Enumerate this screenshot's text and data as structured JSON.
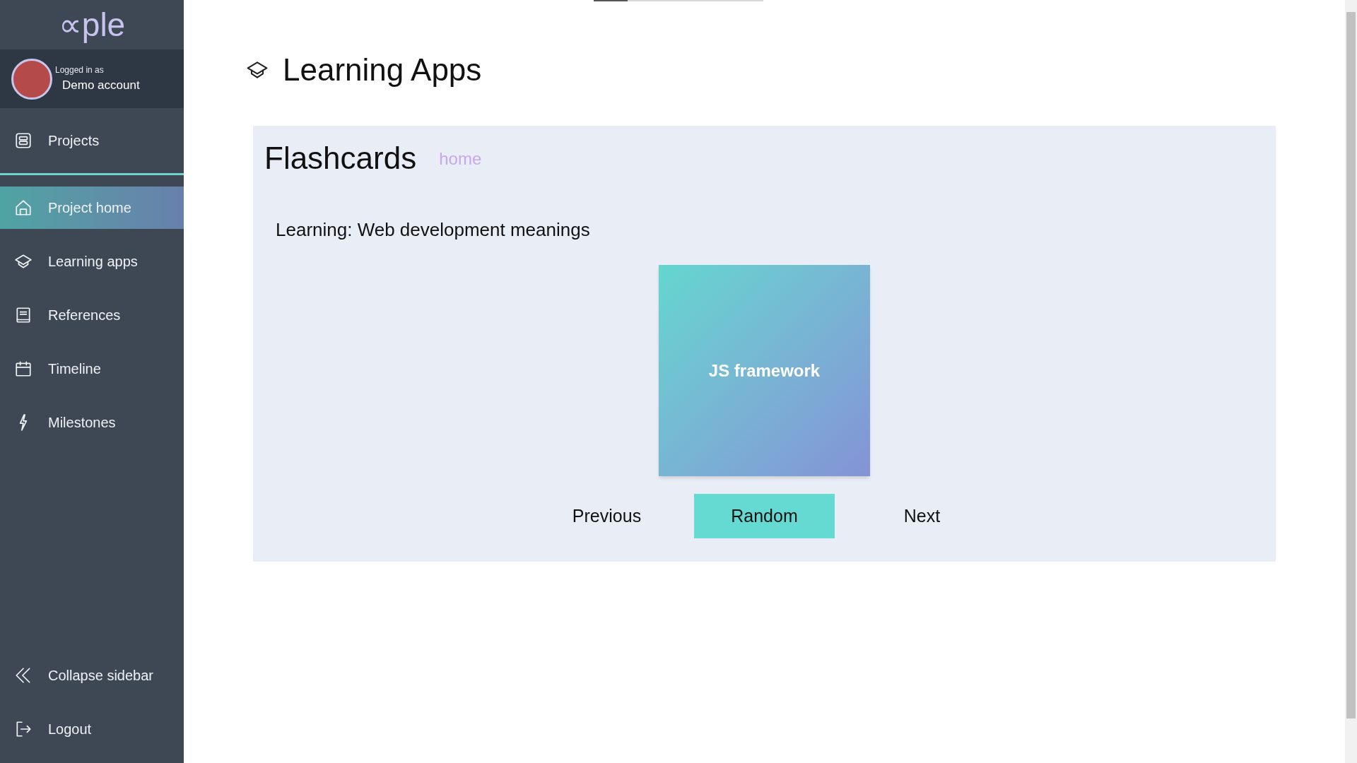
{
  "sidebar": {
    "logo": "∝ple",
    "user": {
      "caption": "Logged in as",
      "name": "Demo account"
    },
    "top_items": [
      {
        "label": "Projects",
        "kind": "projects",
        "selected": false
      }
    ],
    "items": [
      {
        "label": "Project home",
        "kind": "home",
        "selected": true
      },
      {
        "label": "Learning apps",
        "kind": "learning",
        "selected": false
      },
      {
        "label": "References",
        "kind": "references",
        "selected": false
      },
      {
        "label": "Timeline",
        "kind": "timeline",
        "selected": false
      },
      {
        "label": "Milestones",
        "kind": "milestones",
        "selected": false
      }
    ],
    "bottom_items": [
      {
        "label": "Collapse sidebar",
        "kind": "collapse"
      },
      {
        "label": "Logout",
        "kind": "logout"
      }
    ]
  },
  "progress": {
    "level": 0.2
  },
  "page": {
    "title": "Learning Apps"
  },
  "panel": {
    "title": "Flashcards",
    "link": "home",
    "subtitle": "Learning: Web development meanings",
    "card": "JS framework",
    "buttons": [
      {
        "label": "Previous",
        "selected": false
      },
      {
        "label": "Random",
        "selected": true
      },
      {
        "label": "Next",
        "selected": false
      }
    ]
  }
}
